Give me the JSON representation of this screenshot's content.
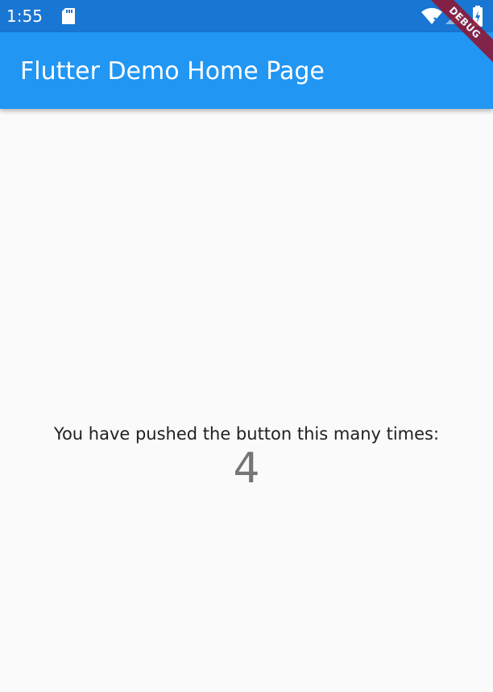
{
  "status_bar": {
    "time": "1:55",
    "icons": [
      "sd-card-icon",
      "wifi-icon",
      "signal-icon",
      "battery-charging-icon"
    ]
  },
  "app_bar": {
    "title": "Flutter Demo Home Page"
  },
  "body": {
    "counter_label": "You have pushed the button this many times:",
    "counter_value": "4"
  },
  "debug_banner": {
    "label": "DEBUG"
  },
  "colors": {
    "status_bar": "#1976d2",
    "app_bar": "#2196f3",
    "background": "#fafafa",
    "debug_banner": "#8b1a3a"
  }
}
